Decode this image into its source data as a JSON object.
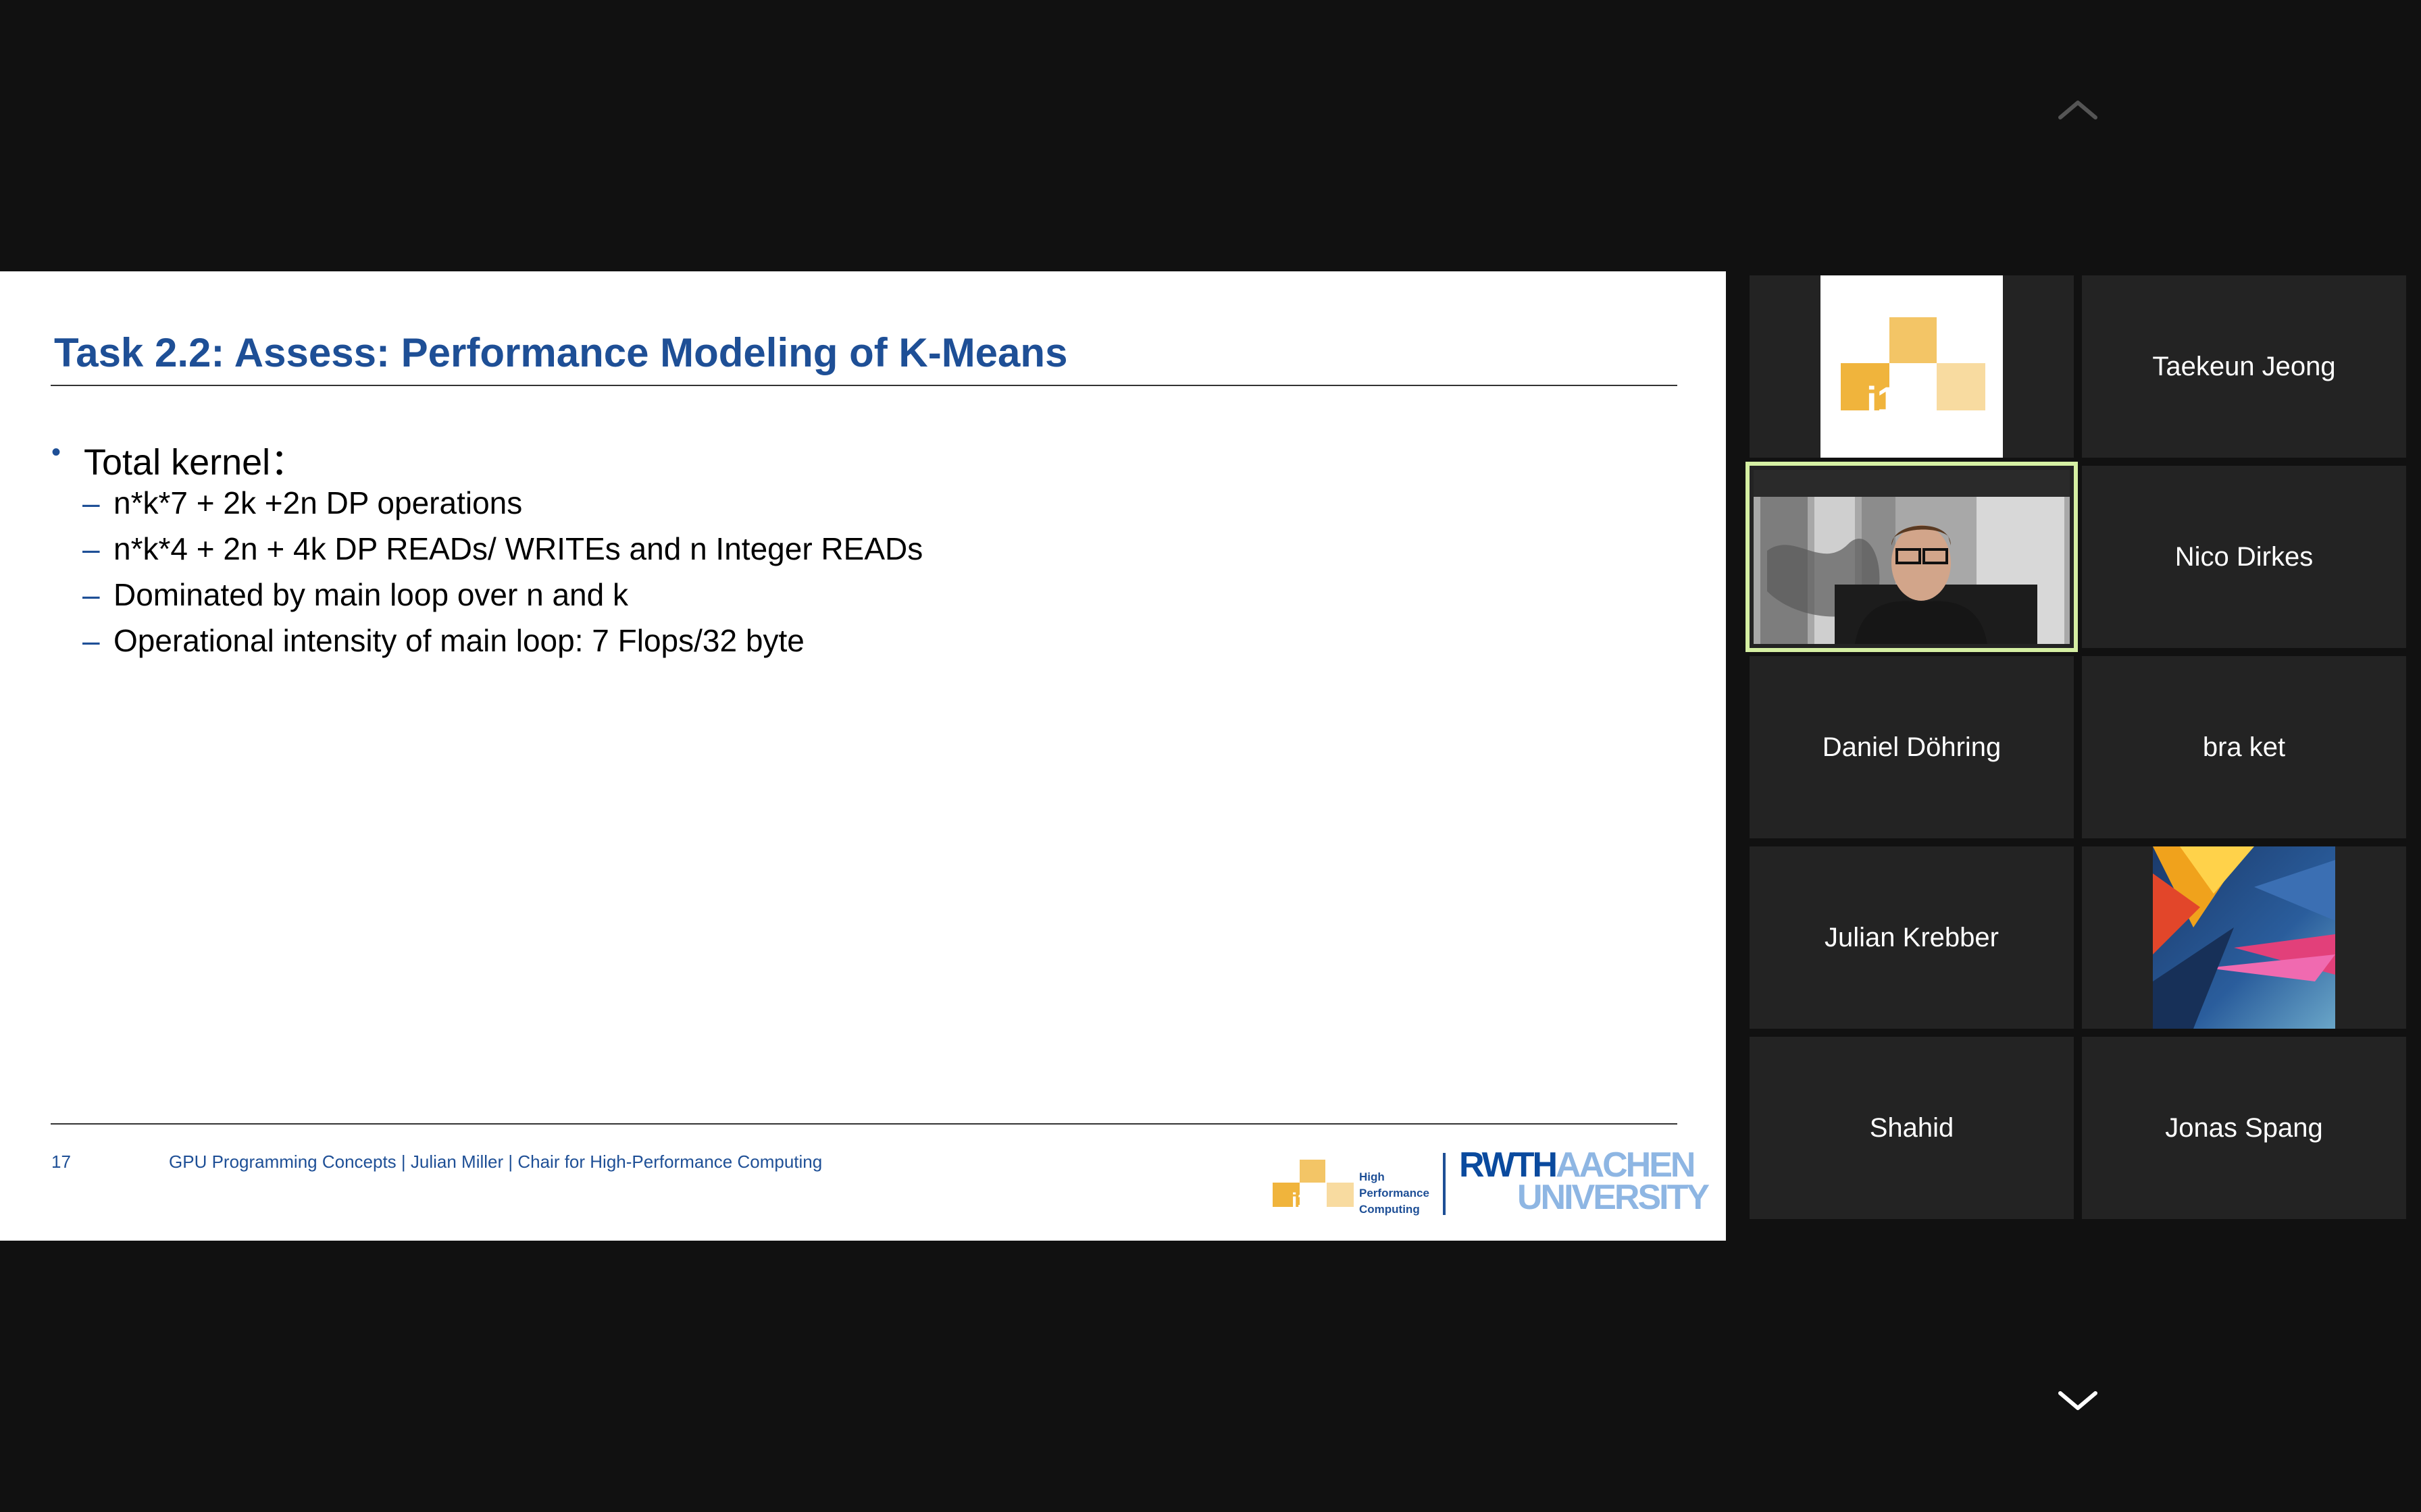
{
  "slide": {
    "title": "Task 2.2: Assess: Performance Modeling of K-Means",
    "bullet_main": "Total kernel：",
    "sub_bullets": [
      "n*k*7 + 2k +2n DP operations",
      "n*k*4 + 2n + 4k DP READs/ WRITEs and n Integer READs",
      "Dominated by main loop over n and k",
      "Operational intensity of main loop: 7 Flops/32 byte"
    ],
    "footer": {
      "page_number": "17",
      "text": "GPU Programming Concepts |  Julian Miller |  Chair for High-Performance Computing"
    },
    "logos": {
      "hpc_mark": "i12",
      "hpc_lines": [
        "High",
        "Performance",
        "Computing"
      ],
      "rwth_part1": "RWTH",
      "rwth_part2": "AACHEN",
      "rwth_part3": "UNIVERSITY"
    }
  },
  "participants": [
    {
      "name": "",
      "avatar": "i12-logo"
    },
    {
      "name": "Taekeun Jeong"
    },
    {
      "name": "",
      "avatar": "video-feed",
      "active_speaker": true
    },
    {
      "name": "Nico Dirkes"
    },
    {
      "name": "Daniel Döhring"
    },
    {
      "name": "bra ket"
    },
    {
      "name": "Julian Krebber"
    },
    {
      "name": "",
      "avatar": "abstract-art"
    },
    {
      "name": "Shahid"
    },
    {
      "name": "Jonas Spang"
    }
  ],
  "controls": {
    "scroll_up_icon": "chevron-up-icon",
    "scroll_down_icon": "chevron-down-icon"
  },
  "colors": {
    "background": "#111111",
    "tile": "#232323",
    "slide_blue": "#1e4f96",
    "active_border": "#d5efa3",
    "i12_orange": "#f0b43c"
  }
}
